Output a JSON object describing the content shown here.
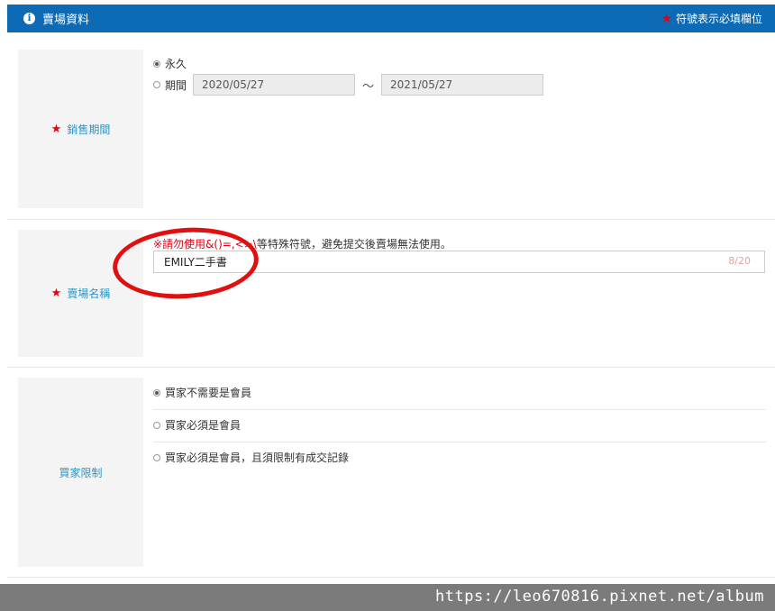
{
  "header": {
    "title": "賣場資料",
    "required_note": "符號表示必填欄位",
    "info_icon": "info-circle-icon",
    "star_icon": "star-icon"
  },
  "sale_period": {
    "label": "銷售期間",
    "option_permanent": "永久",
    "option_period": "期間",
    "start_date": "2020/05/27",
    "end_date": "2021/05/27",
    "separator": "〜",
    "selected": "永久"
  },
  "store_name": {
    "label": "賣場名稱",
    "notice_prefix": "※請勿使用&()=,<>\\",
    "notice_rest": "等特殊符號，避免提交後賣場無法使用。",
    "value": "EMILY二手書",
    "counter": "8/20"
  },
  "buyer_restriction": {
    "label": "買家限制",
    "options": [
      "買家不需要是會員",
      "買家必須是會員",
      "買家必須是會員，且須限制有成交記錄"
    ],
    "selected_index": 0
  },
  "watermark": "https://leo670816.pixnet.net/album",
  "colors": {
    "header_bg": "#0d6ab5",
    "required_star": "#e60012",
    "label_text": "#2a94c5",
    "annotation": "#e01010"
  }
}
